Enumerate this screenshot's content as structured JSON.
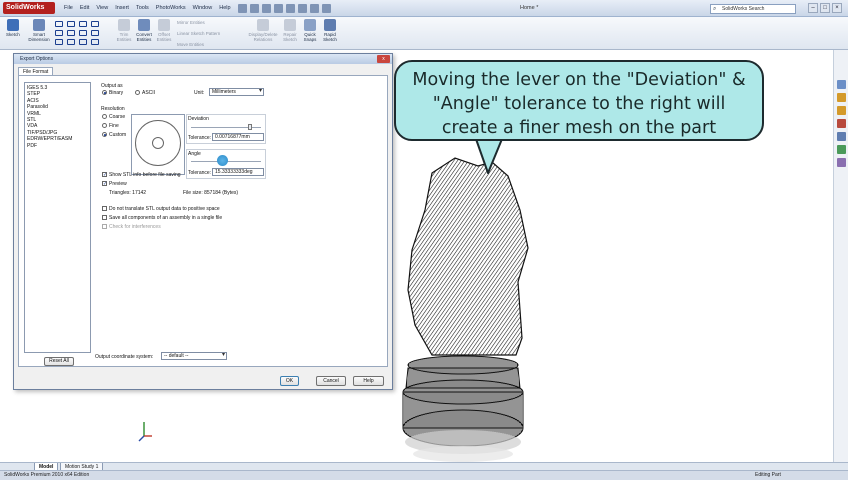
{
  "app": {
    "logo": "SolidWorks",
    "menu": [
      "File",
      "Edit",
      "View",
      "Insert",
      "Tools",
      "PhotoWorks",
      "Window",
      "Help"
    ],
    "document_title": "Home *",
    "search_placeholder": "SolidWorks Search"
  },
  "command_manager": {
    "sketch": "Sketch",
    "smart_dimension": "Smart Dimension",
    "trim_entities": "Trim Entities",
    "convert_entities": "Convert Entities",
    "offset_entities": "Offset Entities",
    "mirror_entities": "Mirror Entities",
    "linear_sketch_pattern": "Linear Sketch Pattern",
    "move_entities": "Move Entities",
    "display_delete_relations": "Display/Delete Relations",
    "repair_sketch": "Repair Sketch",
    "quick_snaps": "Quick Snaps",
    "rapid_sketch": "Rapid Sketch"
  },
  "dialog": {
    "title": "Export Options",
    "close": "x",
    "tab": "File Format",
    "formats": [
      "IGES 5.3",
      "STEP",
      "ACIS",
      "Parasolid",
      "VRML",
      "STL",
      "VDA",
      "TIF/PSD/JPG",
      "EDRW/EPRT/EASM",
      "PDF"
    ],
    "output_as_label": "Output as",
    "binary": "Binary",
    "ascii": "ASCII",
    "unit_label": "Unit:",
    "unit_value": "Millimeters",
    "resolution_label": "Resolution",
    "coarse": "Coarse",
    "fine": "Fine",
    "custom": "Custom",
    "deviation_label": "Deviation",
    "deviation_tolerance_label": "Tolerance:",
    "deviation_tolerance_value": "0.00716877mm",
    "angle_label": "Angle",
    "angle_tolerance_label": "Tolerance:",
    "angle_tolerance_value": "15.33333333deg",
    "show_stl_info": "Show STL info before file saving",
    "preview": "Preview",
    "triangles": "Triangles:  17142",
    "file_size": "File size:  857184 (Bytes)",
    "do_not_translate": "Do not translate STL output data to positive space",
    "save_all_components": "Save all components of an assembly in a single file",
    "check_interferences": "Check for interferences",
    "reset_all": "Reset All",
    "output_coordinate_label": "Output coordinate system:",
    "output_coordinate_value": "-- default --",
    "ok": "OK",
    "cancel": "Cancel",
    "help": "Help"
  },
  "callout": {
    "text": "Moving the lever on the \"Deviation\" & \"Angle\" tolerance to the right will create a finer mesh on the part"
  },
  "tabs": [
    "Model",
    "Motion Study 1"
  ],
  "status": {
    "left": "SolidWorks Premium 2010 x64 Edition",
    "right": "Editing Part"
  },
  "colors": {
    "callout_fill": "#aee8e8",
    "accent_blue": "#2c8bc8",
    "brand_red": "#b3201e"
  }
}
